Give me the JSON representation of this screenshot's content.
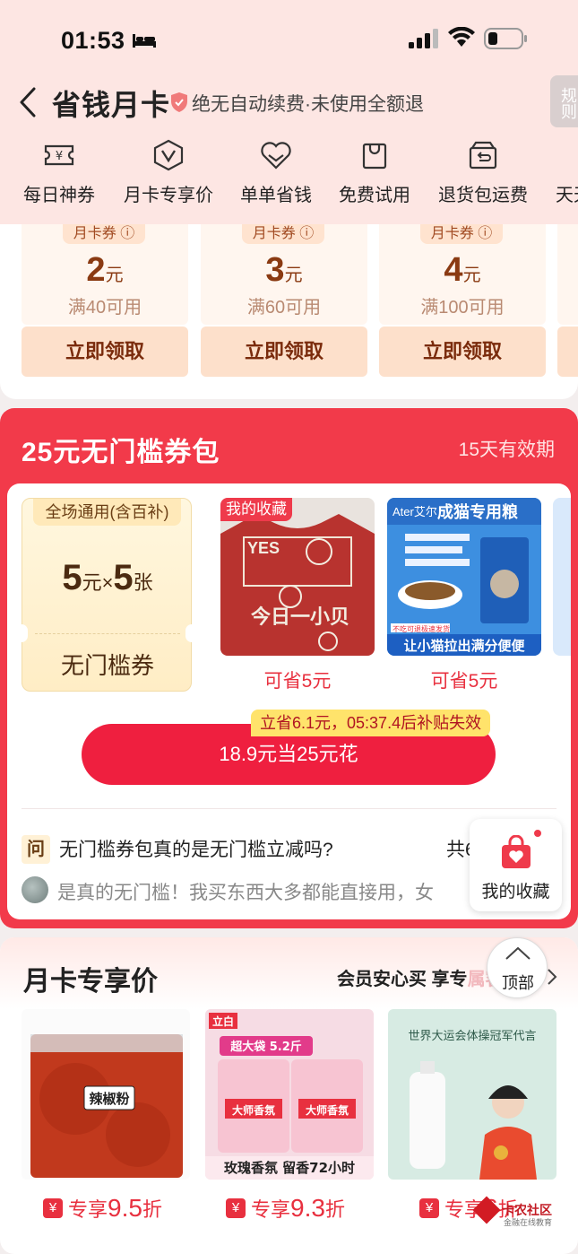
{
  "status": {
    "time": "01:53"
  },
  "nav": {
    "title": "省钱月卡",
    "subtitle": "绝无自动续费·未使用全额退",
    "rules": "规则"
  },
  "categories": [
    {
      "label": "每日神券",
      "icon": "ticket-yen-icon"
    },
    {
      "label": "月卡专享价",
      "icon": "v-badge-icon"
    },
    {
      "label": "单单省钱",
      "icon": "heart-envelope-icon"
    },
    {
      "label": "免费试用",
      "icon": "bag-icon"
    },
    {
      "label": "退货包运费",
      "icon": "return-box-icon"
    },
    {
      "label": "天天",
      "icon": "more-icon"
    }
  ],
  "coupons": [
    {
      "tag": "月卡券",
      "amount": "2",
      "unit": "元",
      "condition": "满40可用",
      "button": "立即领取"
    },
    {
      "tag": "月卡券",
      "amount": "3",
      "unit": "元",
      "condition": "满60可用",
      "button": "立即领取"
    },
    {
      "tag": "月卡券",
      "amount": "4",
      "unit": "元",
      "condition": "满100可用",
      "button": "立即领取"
    }
  ],
  "pack": {
    "title": "25元无门槛券包",
    "validity": "15天有效期",
    "ticket": {
      "tag": "全场通用(含百补)",
      "amount": "5",
      "unit1": "元×",
      "count": "5",
      "unit2": "张",
      "footer": "无门槛券"
    },
    "products": [
      {
        "tag": "我的收藏",
        "save": "可省5元",
        "image_text": "YES",
        "image_text2": "今日一小贝"
      },
      {
        "tag": "",
        "save": "可省5元",
        "brand": "Ater艾尔",
        "image_text": "成猫专用粮",
        "banner": "让小猫拉出满分便便",
        "small1": "不吃可退",
        "small2": "极速发货"
      }
    ],
    "cta_badge": "立省6.1元，05:37.4后补贴失效",
    "cta": "18.9元当25元花",
    "question_icon": "问",
    "question": "无门槛券包真的是无门槛立减吗?",
    "question_count": "共6",
    "answer": "是真的无门槛！我买东西大多都能直接用，女"
  },
  "favorite_float": {
    "label": "我的收藏"
  },
  "exclusive": {
    "title": "月卡专享价",
    "subtitle_a": "会员安心买 享专",
    "subtitle_b": "属客服",
    "top_button": "顶部",
    "items": [
      {
        "image_text": "辣椒粉",
        "label": "专享",
        "price": "9.5",
        "unit": "折"
      },
      {
        "image_text": "超大袋 5.2斤",
        "image_text2": "大师香氛",
        "image_text3": "玫瑰香氛 留香72小时",
        "brand": "立白",
        "label": "专享",
        "price": "9.3",
        "unit": "折"
      },
      {
        "image_text": "世界大运会体操冠军代言",
        "label": "专享",
        "price": "6",
        "unit": "折"
      }
    ]
  },
  "watermark": {
    "line1": "卡农社区",
    "line2": "金融在线教育"
  },
  "colors": {
    "accent_red": "#f23a4a",
    "cta_red": "#ef1f3f",
    "coupon_brown": "#8a3a12",
    "top_pink": "#fde6e3"
  }
}
